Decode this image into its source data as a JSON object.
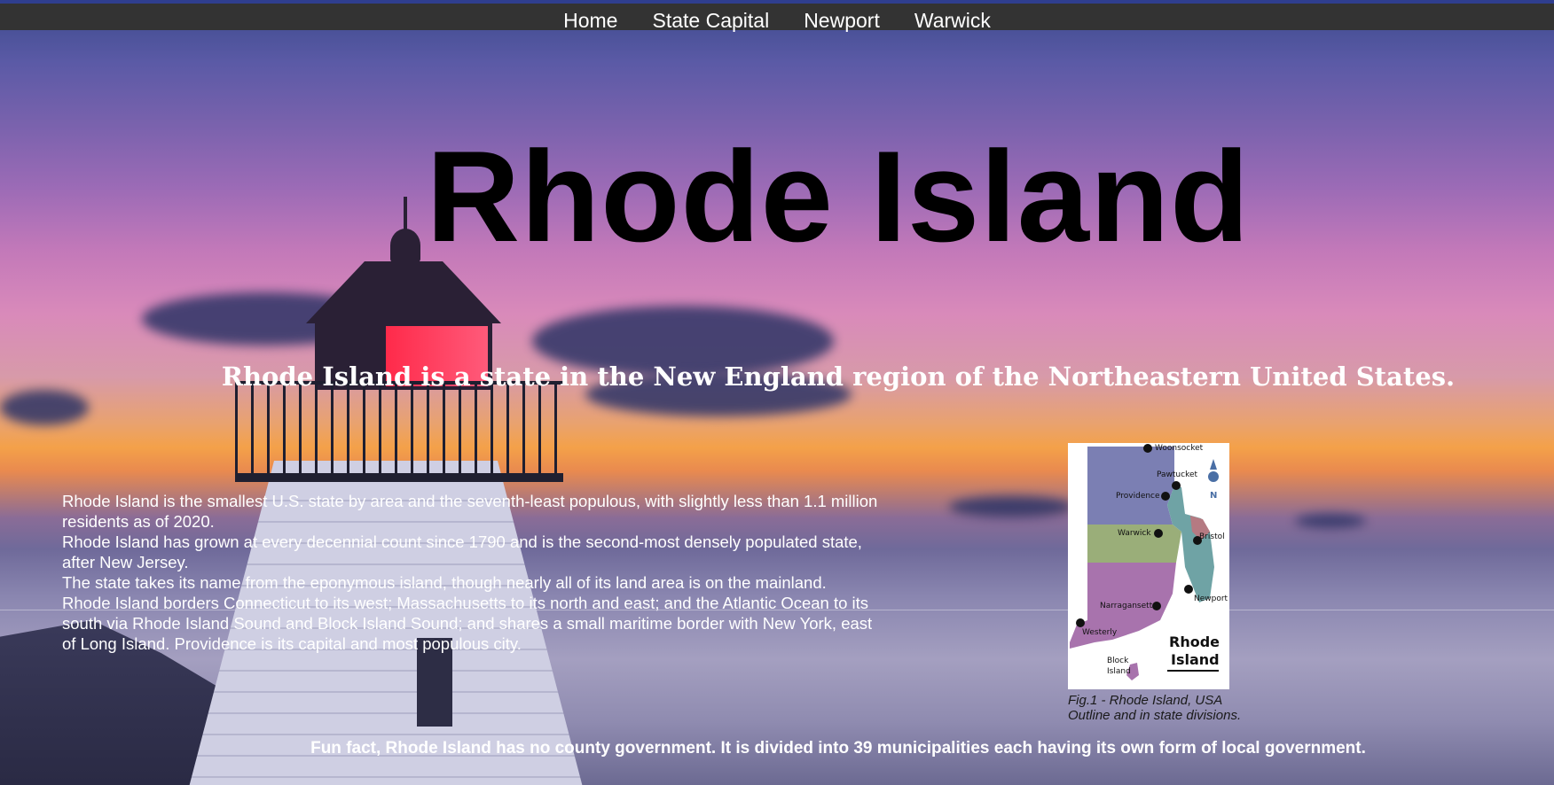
{
  "nav": {
    "items": [
      {
        "label": "Home"
      },
      {
        "label": "State Capital"
      },
      {
        "label": "Newport"
      },
      {
        "label": "Warwick"
      }
    ]
  },
  "hero": {
    "title": "Rhode Island",
    "subtitle": "Rhode Island is a state in the New England region of the Northeastern United States."
  },
  "description": {
    "paragraphs": [
      "Rhode Island is the smallest U.S. state by area and the seventh-least populous, with slightly less than 1.1 million residents as of 2020.",
      "Rhode Island has grown at every decennial count since 1790 and is the second-most densely populated state, after New Jersey.",
      "The state takes its name from the eponymous island, though nearly all of its land area is on the mainland. Rhode Island borders Connecticut to its west; Massachusetts to its north and east; and the Atlantic Ocean to its south via Rhode Island Sound and Block Island Sound; and shares a small maritime border with New York, east of Long Island. Providence is its capital and most populous city."
    ]
  },
  "figure": {
    "map_labels": {
      "woonsocket": "Woonsocket",
      "pawtucket": "Pawtucket",
      "providence": "Providence",
      "warwick": "Warwick",
      "bristol": "Bristol",
      "newport": "Newport",
      "narragansett": "Narragansett",
      "westerly": "Westerly",
      "block_island_1": "Block",
      "block_island_2": "Island",
      "map_title_1": "Rhode",
      "map_title_2": "Island",
      "compass": "N"
    },
    "caption_line1": "Fig.1 - Rhode Island, USA",
    "caption_line2": "Outline and in state divisions."
  },
  "fun_fact": "Fun fact, Rhode Island has no county government. It is divided into 39 municipalities each having its own form of local government.",
  "colors": {
    "nav_bg": "#333333",
    "title": "#000000",
    "text": "#ffffff",
    "region_north": "#7b7fb3",
    "region_central": "#9aae79",
    "region_south": "#a873ad",
    "region_east": "#6fa3a5",
    "region_bristol": "#b57a82"
  }
}
